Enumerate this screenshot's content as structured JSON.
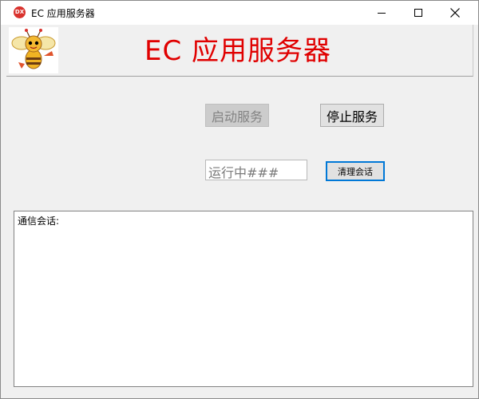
{
  "window": {
    "icon_text": "DX",
    "title": "EC 应用服务器"
  },
  "header": {
    "logo_icon": "bee-mascot-icon",
    "title": "EC 应用服务器"
  },
  "controls": {
    "start_label": "启动服务",
    "stop_label": "停止服务",
    "status_value": "运行中###",
    "clear_label": "清理会话"
  },
  "log": {
    "label": "通信会话:"
  },
  "colors": {
    "title_red": "#e00000",
    "focus_blue": "#0078d7"
  }
}
